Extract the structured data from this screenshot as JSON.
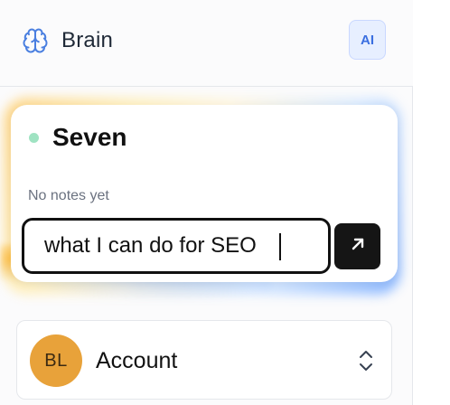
{
  "header": {
    "brand_name": "Brain",
    "brand_icon": "brain-icon",
    "ai_button_label": "AI"
  },
  "card": {
    "title": "Seven",
    "status_color": "#9fe3c2",
    "empty_notes_text": "No notes yet",
    "input_value": "what I can do for SEO",
    "send_icon": "arrow-up-right-icon"
  },
  "account": {
    "avatar_initials": "BL",
    "avatar_color": "#e8a23a",
    "label": "Account",
    "toggle_icon": "chevron-up-down-icon"
  }
}
